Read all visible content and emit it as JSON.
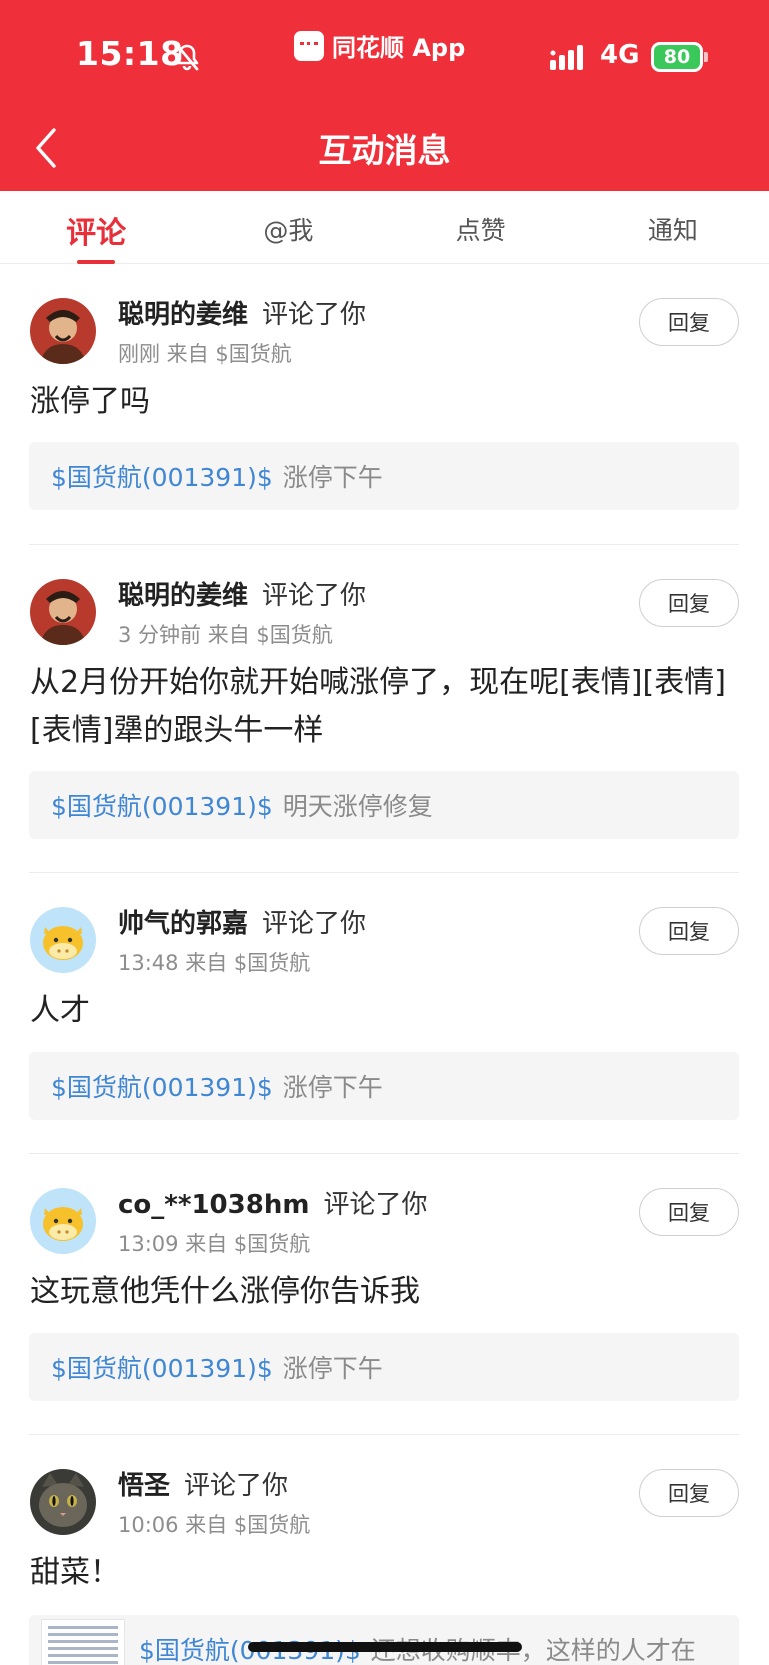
{
  "status_bar": {
    "time": "15:18",
    "app_name": "同花顺 App",
    "network": "4G",
    "battery": "80"
  },
  "header": {
    "title": "互动消息"
  },
  "tabs": [
    {
      "label": "评论",
      "active": true
    },
    {
      "label": "@我",
      "active": false
    },
    {
      "label": "点赞",
      "active": false
    },
    {
      "label": "通知",
      "active": false
    }
  ],
  "reply_label": "回复",
  "comments": [
    {
      "user": "聪明的姜维",
      "action": "评论了你",
      "meta": "刚刚  来自  $国货航",
      "text": "涨停了吗",
      "quote_stock": "$国货航(001391)$",
      "quote_text": "涨停下午"
    },
    {
      "user": "聪明的姜维",
      "action": "评论了你",
      "meta": "3 分钟前  来自  $国货航",
      "text": "从2月份开始你就开始喊涨停了，现在呢[表情][表情][表情]犟的跟头牛一样",
      "quote_stock": "$国货航(001391)$",
      "quote_text": "明天涨停修复"
    },
    {
      "user": "帅气的郭嘉",
      "action": "评论了你",
      "meta": "13:48  来自  $国货航",
      "text": "人才",
      "quote_stock": "$国货航(001391)$",
      "quote_text": "涨停下午"
    },
    {
      "user": "co_**1038hm",
      "action": "评论了你",
      "meta": "13:09  来自  $国货航",
      "text": "这玩意他凭什么涨停你告诉我",
      "quote_stock": "$国货航(001391)$",
      "quote_text": "涨停下午"
    },
    {
      "user": "悟圣",
      "action": "评论了你",
      "meta": "10:06  来自  $国货航",
      "text": "甜菜！",
      "quote_stock": "$国货航(001391)$",
      "quote_text": "还想收购顺丰，这样的人才在"
    }
  ],
  "colors": {
    "brand_red": "#ef2f3a",
    "link_blue": "#3f86d4"
  }
}
